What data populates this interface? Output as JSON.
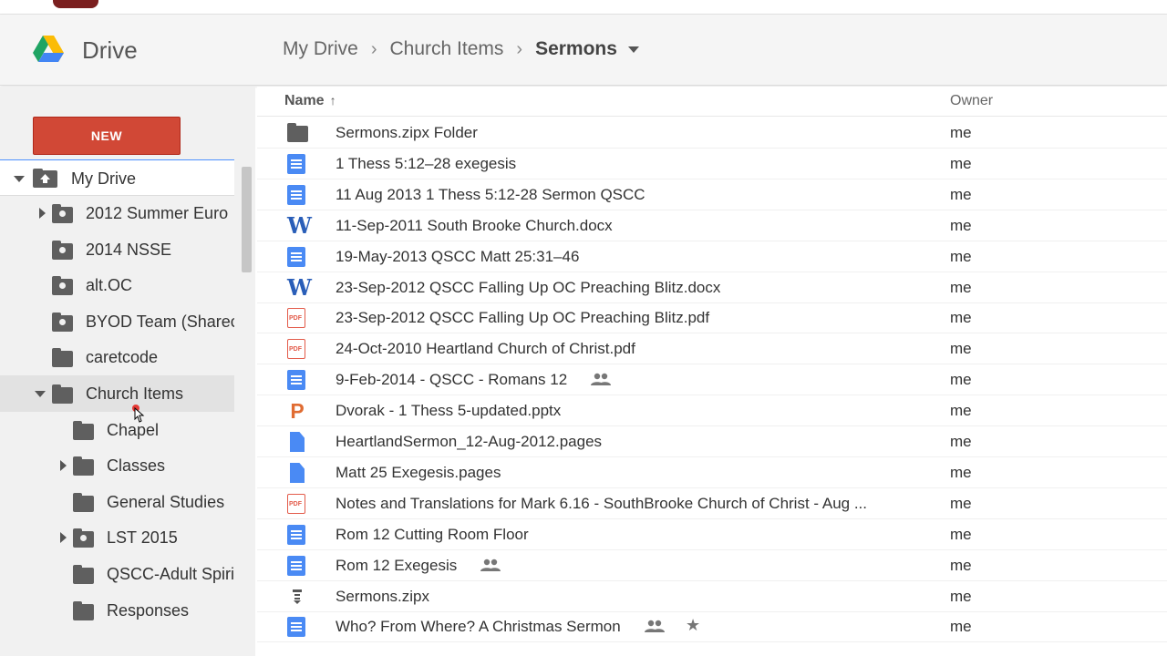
{
  "app": {
    "title": "Drive"
  },
  "breadcrumb": {
    "items": [
      "My Drive",
      "Church Items"
    ],
    "separator": "›",
    "current": "Sermons"
  },
  "sidebar": {
    "new_label": "NEW",
    "my_drive_label": "My Drive",
    "folders": [
      {
        "label": "2012 Summer Euro",
        "type": "shared",
        "expand": "collapsed"
      },
      {
        "label": "2014 NSSE",
        "type": "shared",
        "expand": "none"
      },
      {
        "label": "alt.OC",
        "type": "shared",
        "expand": "none"
      },
      {
        "label": "BYOD Team (Sharec",
        "type": "shared",
        "expand": "none"
      },
      {
        "label": "caretcode",
        "type": "folder",
        "expand": "none"
      },
      {
        "label": "Church Items",
        "type": "folder",
        "expand": "expanded",
        "selected": true
      },
      {
        "label": "Chapel",
        "type": "folder",
        "expand": "none"
      },
      {
        "label": "Classes",
        "type": "folder",
        "expand": "collapsed"
      },
      {
        "label": "General Studies",
        "type": "folder",
        "expand": "none"
      },
      {
        "label": "LST 2015",
        "type": "shared",
        "expand": "collapsed"
      },
      {
        "label": "QSCC-Adult Spiriti",
        "type": "folder",
        "expand": "none"
      },
      {
        "label": "Responses",
        "type": "folder",
        "expand": "none"
      }
    ]
  },
  "list": {
    "header_name": "Name",
    "header_sort_arrow": "↑",
    "header_owner": "Owner",
    "rows": [
      {
        "name": "Sermons.zipx Folder",
        "icon": "folder-icon",
        "owner": "me"
      },
      {
        "name": "1 Thess 5:12–28 exegesis",
        "icon": "google-doc-icon",
        "owner": "me"
      },
      {
        "name": "11 Aug 2013 1 Thess 5:12-28 Sermon QSCC",
        "icon": "google-doc-icon",
        "owner": "me"
      },
      {
        "name": "11-Sep-2011 South Brooke Church.docx",
        "icon": "word-icon",
        "owner": "me"
      },
      {
        "name": "19-May-2013 QSCC Matt 25:31–46",
        "icon": "google-doc-icon",
        "owner": "me"
      },
      {
        "name": "23-Sep-2012 QSCC Falling Up OC Preaching Blitz.docx",
        "icon": "word-icon",
        "owner": "me"
      },
      {
        "name": "23-Sep-2012 QSCC Falling Up OC Preaching Blitz.pdf",
        "icon": "pdf-icon",
        "owner": "me"
      },
      {
        "name": "24-Oct-2010 Heartland Church of Christ.pdf",
        "icon": "pdf-icon",
        "owner": "me"
      },
      {
        "name": "9-Feb-2014 - QSCC - Romans 12",
        "icon": "google-doc-icon",
        "owner": "me",
        "shared": true
      },
      {
        "name": "Dvorak - 1 Thess 5-updated.pptx",
        "icon": "powerpoint-icon",
        "owner": "me"
      },
      {
        "name": "HeartlandSermon_12-Aug-2012.pages",
        "icon": "file-icon",
        "owner": "me"
      },
      {
        "name": "Matt 25 Exegesis.pages",
        "icon": "file-icon",
        "owner": "me"
      },
      {
        "name": "Notes and Translations for Mark 6.16 - SouthBrooke Church of Christ - Aug ...",
        "icon": "pdf-icon",
        "owner": "me"
      },
      {
        "name": "Rom 12 Cutting Room Floor",
        "icon": "google-doc-icon",
        "owner": "me"
      },
      {
        "name": "Rom 12 Exegesis",
        "icon": "google-doc-icon",
        "owner": "me",
        "shared": true
      },
      {
        "name": "Sermons.zipx",
        "icon": "zip-icon",
        "owner": "me"
      },
      {
        "name": "Who? From Where? A Christmas Sermon",
        "icon": "google-doc-icon",
        "owner": "me",
        "shared": true,
        "starred": true
      }
    ]
  },
  "icons": {
    "pdf_label": "PDF",
    "word_glyph": "W",
    "ppt_glyph": "P",
    "star_glyph": "★"
  },
  "colors": {
    "new_button": "#d14836",
    "doc_blue": "#4a8af4",
    "pdf_red": "#e35b4a",
    "selection_bar": "#4d90fe"
  }
}
